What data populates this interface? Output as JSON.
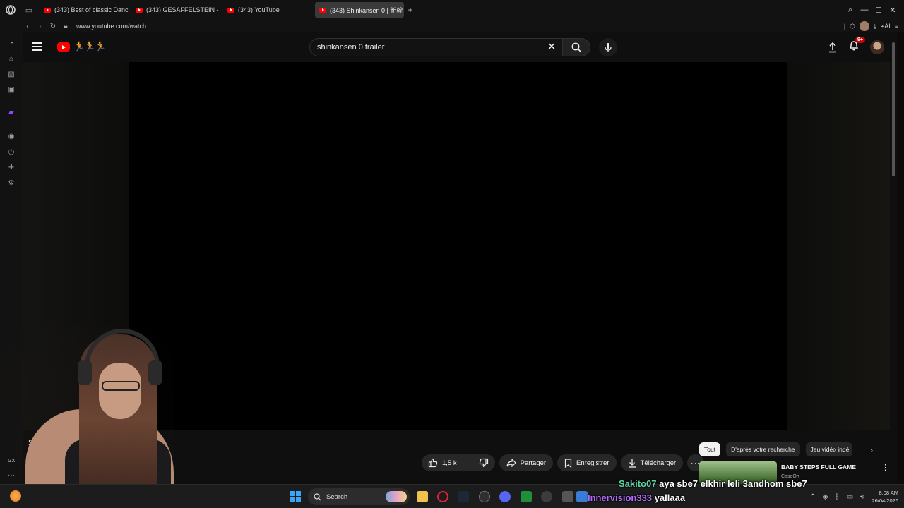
{
  "browser": {
    "tabs": [
      {
        "label": "(343) Best of classic Danc",
        "active": false
      },
      {
        "label": "(343) GESAFFELSTEIN - D",
        "active": false
      },
      {
        "label": "(343) YouTube",
        "active": false
      },
      {
        "label": "(343) Shinkansen 0 | 新幹",
        "active": true
      }
    ],
    "new_tab": "+",
    "url": "www.youtube.com/watch",
    "ai_label": "AI"
  },
  "sidebar": {
    "gx_label": "GX",
    "more": "···"
  },
  "youtube": {
    "doodle": "🏃🏃🏃",
    "search_value": "shinkansen 0 trailer",
    "notif_badge": "9+",
    "video_title_visible_fragment_left": "S",
    "video_title_visible_fragment_right": "iler",
    "actions": {
      "like_count": "1,5 k",
      "share": "Partager",
      "save": "Enregistrer",
      "download": "Télécharger"
    },
    "chips": [
      {
        "label": "Tout",
        "selected": true
      },
      {
        "label": "D'après votre recherche",
        "selected": false
      },
      {
        "label": "Jeu vidéo indé",
        "selected": false
      }
    ],
    "recommendation": {
      "title": "BABY STEPS FULL GAME",
      "channel": "CaseOh"
    }
  },
  "chat": [
    {
      "user": "Sakito07",
      "message": "aya sbe7 elkhir leli 3andhom sbe7"
    },
    {
      "user": "Innervision333",
      "message": "yallaaa"
    }
  ],
  "taskbar": {
    "search_label": "Search",
    "time": "8:08 AM",
    "date": "26/04/2026"
  },
  "colors": {
    "youtube_red": "#ff0000",
    "chat_user1": "#5fd6a3",
    "chat_user2": "#b06cff",
    "twitch_purple": "#9147ff"
  }
}
